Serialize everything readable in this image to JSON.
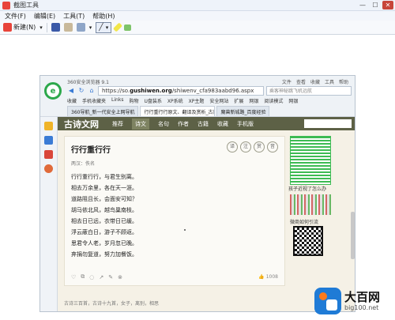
{
  "window": {
    "title": "截图工具",
    "controls": [
      "—",
      "☐",
      "✕"
    ]
  },
  "menu": [
    "文件(F)",
    "编辑(E)",
    "工具(T)",
    "帮助(H)"
  ],
  "toolbar": {
    "new_label": "新建(N)"
  },
  "browser": {
    "app_name": "360安全浏览器 9.1",
    "menu": [
      "文件",
      "查看",
      "收藏",
      "工具",
      "帮助"
    ],
    "url_prefix": "https://so.",
    "url_domain": "gushiwen.org",
    "url_path": "/shiwenv_cfa983aabd96.aspx",
    "search_placeholder": "乘客神秘跳飞机远航",
    "bookmarks": [
      "收藏",
      "手机收藏夹",
      "Links",
      "购物",
      "U盘装系",
      "XP系统",
      "XP主题",
      "安全网站",
      "扩展",
      "网银",
      "阅读模式",
      "网银"
    ],
    "tabs": [
      "360导航_新一代安全上网导航",
      "行行重行行原文、翻译及赏析_古诗",
      "魔兽新城路_百度经验"
    ]
  },
  "site": {
    "logo": "古诗文网",
    "nav": [
      "推荐",
      "诗文",
      "名句",
      "作者",
      "古籍",
      "收藏",
      "手机版"
    ],
    "active_nav": "诗文"
  },
  "poem": {
    "title": "行行重行行",
    "author": "两汉：佚名",
    "lines": [
      "行行重行行，与君生别离。",
      "相去万余里，各在天一涯。",
      "道路阻且长，会面安可知？",
      "胡马依北风，越鸟巢南枝。",
      "相去日已远，衣带日已缓。",
      "浮云蔽白日，游子不顾返。",
      "思君令人老，岁月忽已晚。",
      "弃捐勿复道，努力加餐饭。"
    ],
    "actions": [
      "译",
      "注",
      "赏",
      "音"
    ],
    "likes": "1008",
    "tags": "古诗三百首，古诗十九首，女子，离别，相思"
  },
  "right": {
    "caption1": "孩子近视了怎么办",
    "caption2": "微商如何引流"
  },
  "watermark": {
    "title": "大百网",
    "url": "big100.net"
  },
  "colors": {
    "site_nav": "#5d6146",
    "page_bg": "#f5f1e6",
    "browser_logo": "#2ca84b"
  }
}
